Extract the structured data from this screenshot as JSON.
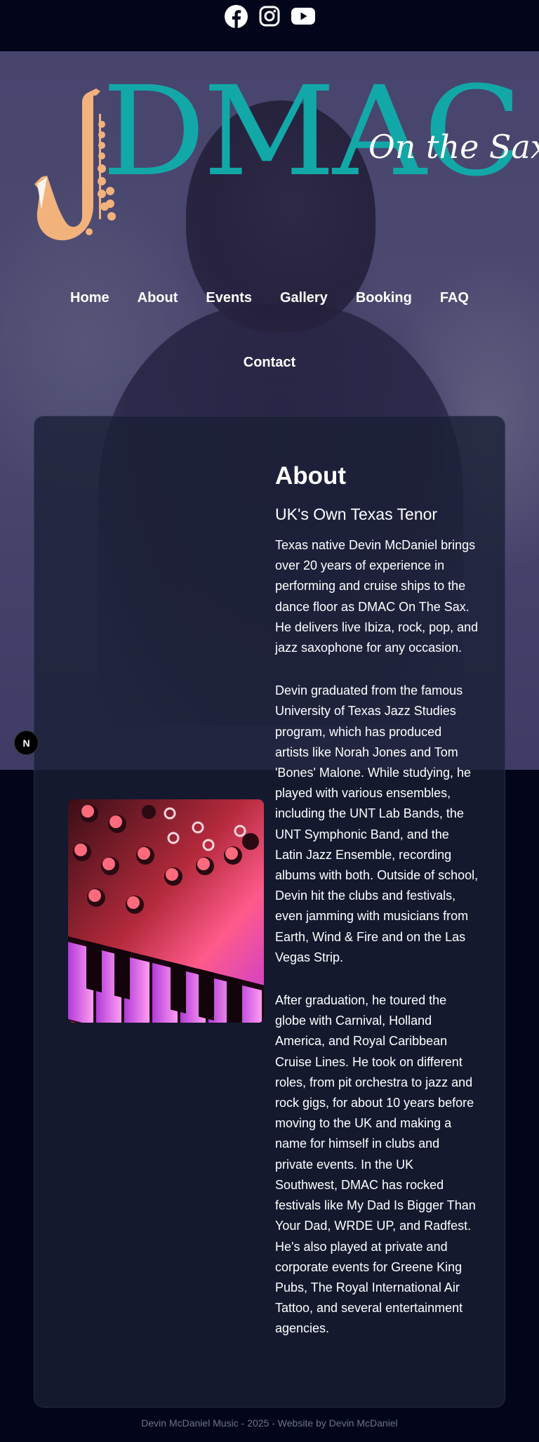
{
  "social": {
    "icons": [
      "facebook-icon",
      "instagram-icon",
      "youtube-icon"
    ]
  },
  "logo": {
    "wordmark": "DMAC",
    "tagline": "On the Sax",
    "colors": {
      "wordmark": "#12a8a8",
      "sax": "#f2b27c"
    }
  },
  "nav": {
    "items": [
      {
        "label": "Home"
      },
      {
        "label": "About"
      },
      {
        "label": "Events"
      },
      {
        "label": "Gallery"
      },
      {
        "label": "Booking"
      },
      {
        "label": "FAQ"
      },
      {
        "label": "Contact"
      }
    ]
  },
  "about": {
    "title": "About",
    "subtitle": "UK's Own Texas Tenor",
    "paragraphs": [
      "Texas native Devin McDaniel brings over 20 years of experience in performing and cruise ships to the dance floor as DMAC On The Sax. He delivers live Ibiza, rock, pop, and jazz saxophone for any occasion.",
      "Devin graduated from the famous University of Texas Jazz Studies program, which has produced artists like Norah Jones and Tom 'Bones' Malone. While studying, he played with various ensembles, including the UNT Lab Bands, the UNT Symphonic Band, and the Latin Jazz Ensemble, recording albums with both. Outside of school, Devin hit the clubs and festivals, even jamming with musicians from Earth, Wind & Fire and on the Las Vegas Strip.",
      "After graduation, he toured the globe with Carnival, Holland America, and Royal Caribbean Cruise Lines. He took on different roles, from pit orchestra to jazz and rock gigs, for about 10 years before moving to the UK and making a name for himself in clubs and private events. In the UK Southwest, DMAC has rocked festivals like My Dad Is Bigger Than Your Dad, WRDE UP, and Radfest. He's also played at private and corporate events for Greene King Pubs, The Royal International Air Tattoo, and several entertainment agencies."
    ]
  },
  "badge": {
    "label": "N"
  },
  "footer": {
    "text": "Devin McDaniel Music - 2025 - Website by Devin McDaniel"
  }
}
